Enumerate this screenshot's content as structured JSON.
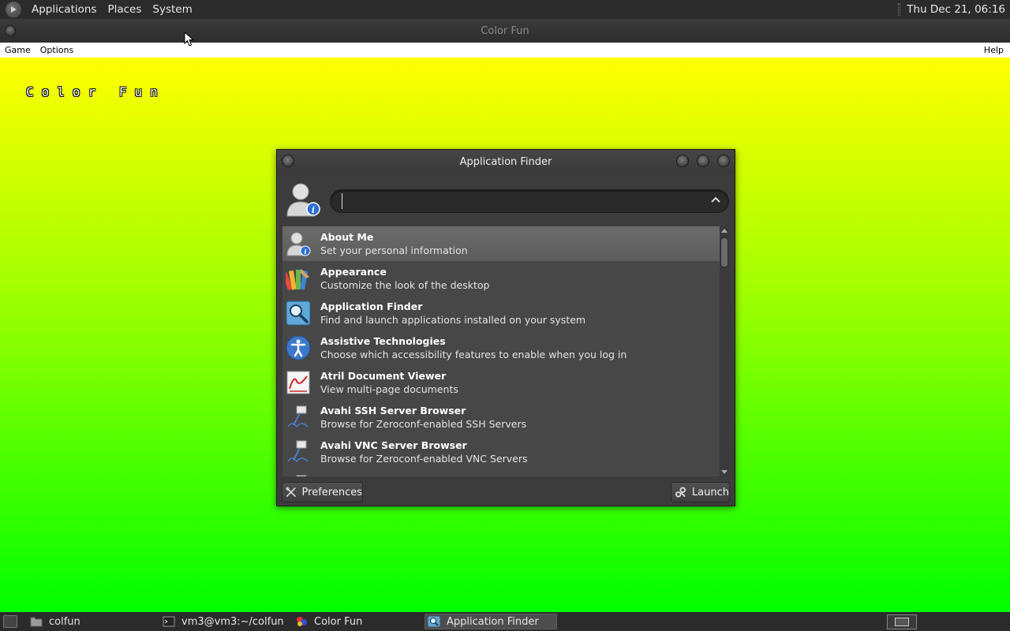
{
  "top_panel": {
    "menus": [
      "Applications",
      "Places",
      "System"
    ],
    "clock": "Thu Dec 21, 06:16"
  },
  "colorfun": {
    "window_title": "Color Fun",
    "menu": {
      "game": "Game",
      "options": "Options",
      "help": "Help"
    },
    "canvas_title": "Color Fun"
  },
  "app_finder": {
    "title": "Application Finder",
    "search": {
      "value": "",
      "placeholder": ""
    },
    "items": [
      {
        "name": "About Me",
        "desc": "Set your personal information",
        "icon": "user-info-icon"
      },
      {
        "name": "Appearance",
        "desc": "Customize the look of the desktop",
        "icon": "appearance-palette-icon"
      },
      {
        "name": "Application Finder",
        "desc": "Find and launch applications installed on your system",
        "icon": "magnifier-icon"
      },
      {
        "name": "Assistive Technologies",
        "desc": "Choose which accessibility features to enable when you log in",
        "icon": "accessibility-icon"
      },
      {
        "name": "Atril Document Viewer",
        "desc": "View multi-page documents",
        "icon": "document-viewer-icon"
      },
      {
        "name": "Avahi SSH Server Browser",
        "desc": "Browse for Zeroconf-enabled SSH Servers",
        "icon": "network-browser-icon"
      },
      {
        "name": "Avahi VNC Server Browser",
        "desc": "Browse for Zeroconf-enabled VNC Servers",
        "icon": "network-browser-icon"
      }
    ],
    "preferences_label": "Preferences",
    "launch_label": "Launch"
  },
  "taskbar": {
    "tasks": [
      "colfun",
      "vm3@vm3:~/colfun",
      "Color Fun",
      "Application Finder"
    ]
  },
  "colors": {
    "panel": "#2b2b2b",
    "canvas_top": "#ffff00",
    "canvas_bottom": "#00ff00",
    "dialog_bg": "#3c3c3c",
    "selected_row": "#666666"
  }
}
